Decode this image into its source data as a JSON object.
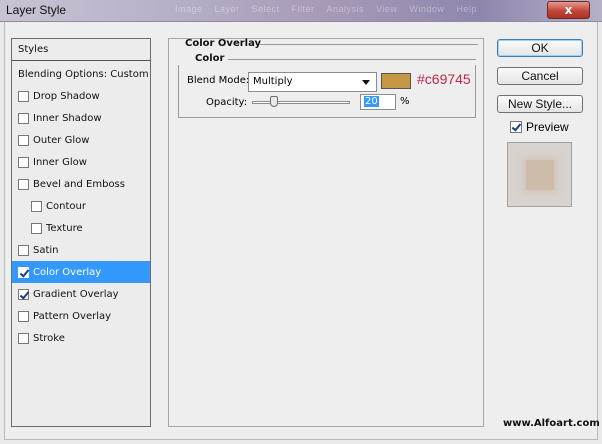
{
  "window": {
    "title": "Layer Style",
    "close_label": "x",
    "ghost_menu": [
      "Image",
      "Layer",
      "Select",
      "Filter",
      "Analysis",
      "View",
      "Window",
      "Help"
    ]
  },
  "styles_list": {
    "header": "Styles",
    "blending": "Blending Options: Custom",
    "items": [
      {
        "label": "Drop Shadow",
        "checked": false,
        "indent": false,
        "selected": false
      },
      {
        "label": "Inner Shadow",
        "checked": false,
        "indent": false,
        "selected": false
      },
      {
        "label": "Outer Glow",
        "checked": false,
        "indent": false,
        "selected": false
      },
      {
        "label": "Inner Glow",
        "checked": false,
        "indent": false,
        "selected": false
      },
      {
        "label": "Bevel and Emboss",
        "checked": false,
        "indent": false,
        "selected": false
      },
      {
        "label": "Contour",
        "checked": false,
        "indent": true,
        "selected": false
      },
      {
        "label": "Texture",
        "checked": false,
        "indent": true,
        "selected": false
      },
      {
        "label": "Satin",
        "checked": false,
        "indent": false,
        "selected": false
      },
      {
        "label": "Color Overlay",
        "checked": true,
        "indent": false,
        "selected": true
      },
      {
        "label": "Gradient Overlay",
        "checked": true,
        "indent": false,
        "selected": false
      },
      {
        "label": "Pattern Overlay",
        "checked": false,
        "indent": false,
        "selected": false
      },
      {
        "label": "Stroke",
        "checked": false,
        "indent": false,
        "selected": false
      }
    ]
  },
  "panel": {
    "title": "Color Overlay",
    "subtitle": "Color",
    "blend_label": "Blend Mode:",
    "blend_value": "Multiply",
    "color_hex": "#c69745",
    "hex_text": "#c69745",
    "opacity_label": "Opacity:",
    "opacity_value": "20",
    "opacity_unit": "%",
    "opacity_fraction": 0.2
  },
  "buttons": {
    "ok": "OK",
    "cancel": "Cancel",
    "new_style": "New Style..."
  },
  "preview": {
    "label": "Preview",
    "checked": true
  },
  "watermark": "www.Alfoart.com"
}
